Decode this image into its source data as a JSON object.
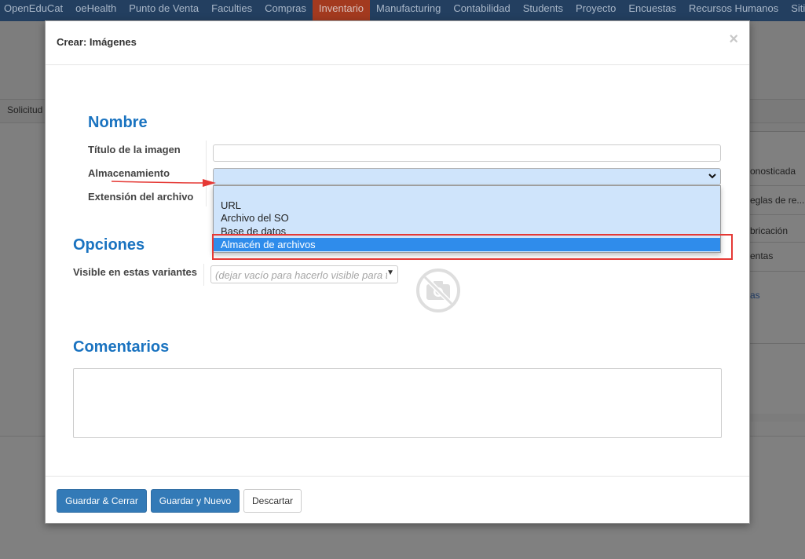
{
  "topnav": {
    "items": [
      "OpenEduCat",
      "oeHealth",
      "Punto de Venta",
      "Faculties",
      "Compras",
      "Inventario",
      "Manufacturing",
      "Contabilidad",
      "Students",
      "Proyecto",
      "Encuestas",
      "Recursos Humanos",
      "Siti"
    ],
    "active_index": 5
  },
  "background": {
    "strip_label": "Solicitud",
    "right_items": [
      "onosticada",
      "eglas de re...",
      "bricación",
      "entas",
      "as"
    ]
  },
  "modal": {
    "title": "Crear: Imágenes",
    "close_glyph": "×",
    "sections": {
      "nombre": "Nombre",
      "opciones": "Opciones",
      "comentarios": "Comentarios"
    },
    "fields": {
      "titulo_label": "Título de la imagen",
      "titulo_value": "",
      "almacenamiento_label": "Almacenamiento",
      "almacenamiento_value": "",
      "extension_label": "Extensión del archivo",
      "visible_label": "Visible en estas variantes",
      "visible_placeholder": "(dejar vacío para hacerlo visible para todas)",
      "comentarios_value": ""
    },
    "dropdown": {
      "options": [
        "",
        "URL",
        "Archivo del SO",
        "Base de datos",
        "Almacén de archivos"
      ],
      "highlighted_index": 4
    },
    "buttons": {
      "save_close": "Guardar & Cerrar",
      "save_new": "Guardar y Nuevo",
      "discard": "Descartar"
    }
  },
  "colors": {
    "nav_bg": "#233f60",
    "nav_active": "#a33a1f",
    "section_title": "#1a73c0",
    "primary_button": "#337ab7",
    "dropdown_bg": "#cfe4fb",
    "dropdown_selected": "#2f8ceb",
    "annotation_red": "#e53935"
  },
  "icons": {
    "close": "close-icon",
    "select_chevron": "chevron-down-icon",
    "no_image": "no-camera-icon",
    "resize_grip": "resize-grip-icon"
  }
}
